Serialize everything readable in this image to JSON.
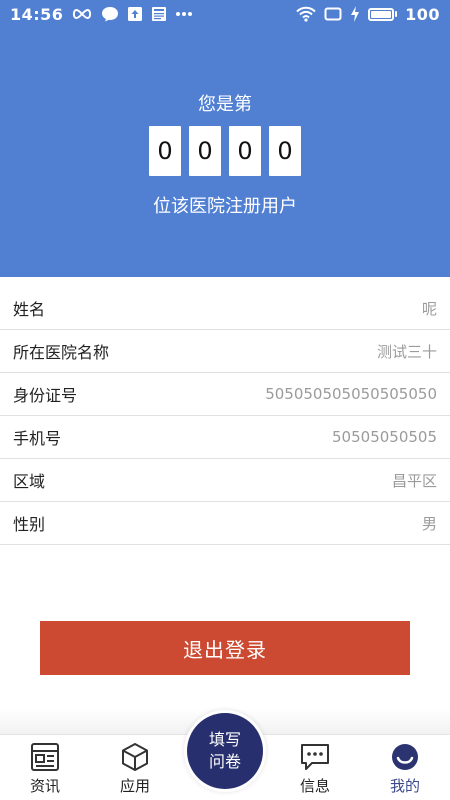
{
  "status_bar": {
    "time": "14:56",
    "battery": "100"
  },
  "hero": {
    "pre_text": "您是第",
    "digits": [
      "0",
      "0",
      "0",
      "0"
    ],
    "post_text": "位该医院注册用户"
  },
  "profile": {
    "rows": [
      {
        "label": "姓名",
        "value": "呢"
      },
      {
        "label": "所在医院名称",
        "value": "测试三十"
      },
      {
        "label": "身份证号",
        "value": "505050505050505050"
      },
      {
        "label": "手机号",
        "value": "50505050505"
      },
      {
        "label": "区域",
        "value": "昌平区"
      },
      {
        "label": "性别",
        "value": "男"
      }
    ]
  },
  "logout_label": "退出登录",
  "tabbar": {
    "items": [
      {
        "label": "资讯",
        "icon": "news-icon"
      },
      {
        "label": "应用",
        "icon": "cube-icon"
      },
      {
        "label": "信息",
        "icon": "message-icon"
      },
      {
        "label": "我的",
        "icon": "profile-icon",
        "active": true
      }
    ],
    "center_button": "填写问卷"
  },
  "colors": {
    "header_blue": "#5180d3",
    "logout_red": "#cc4a32",
    "fab_navy": "#272f6e"
  }
}
